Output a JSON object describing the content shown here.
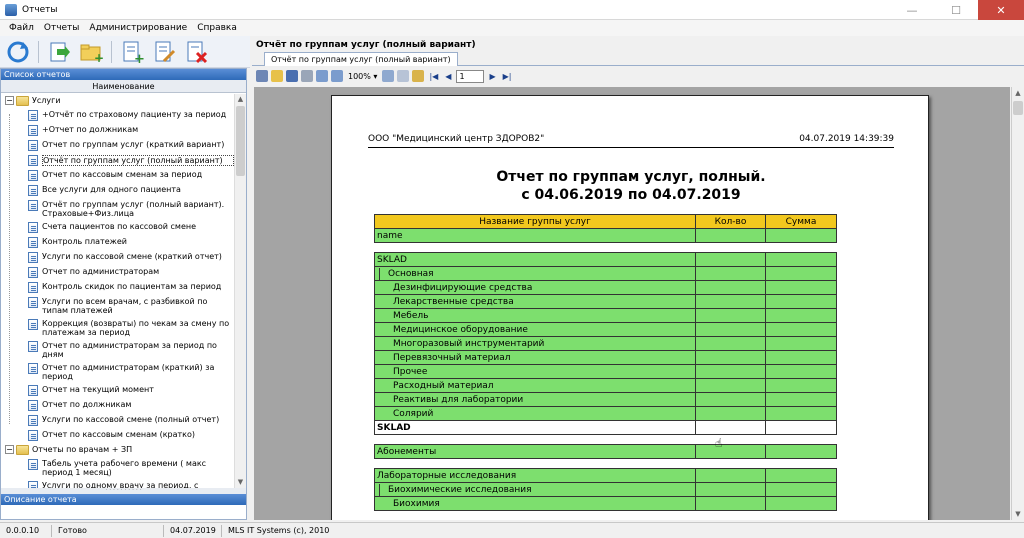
{
  "window": {
    "title": "Отчеты",
    "minimize": "—",
    "maximize": "☐",
    "close": "✕"
  },
  "menu": [
    "Файл",
    "Отчеты",
    "Администрирование",
    "Справка"
  ],
  "left_panel": {
    "header": "Список отчетов",
    "column": "Наименование",
    "description_header": "Описание отчета",
    "tree": [
      {
        "type": "folder",
        "label": "Услуги"
      },
      {
        "type": "doc",
        "label": "+Отчёт по страховому пациенту за период"
      },
      {
        "type": "doc",
        "label": " +Отчет по должникам"
      },
      {
        "type": "doc",
        "label": "Отчет по группам услуг (краткий вариант)"
      },
      {
        "type": "doc",
        "label": "Отчёт по группам услуг (полный вариант)",
        "selected": true
      },
      {
        "type": "doc",
        "label": "Отчет по кассовым сменам за период"
      },
      {
        "type": "doc",
        "label": "Все услуги для одного пациента"
      },
      {
        "type": "doc",
        "label": "Отчёт по группам услуг (полный вариант). Страховые+Физ.лица"
      },
      {
        "type": "doc",
        "label": "Счета пациентов по кассовой смене"
      },
      {
        "type": "doc",
        "label": "Контроль платежей"
      },
      {
        "type": "doc",
        "label": "Услуги по кассовой смене  (краткий отчет)"
      },
      {
        "type": "doc",
        "label": "Отчет по администраторам"
      },
      {
        "type": "doc",
        "label": "Контроль скидок по пациентам за период"
      },
      {
        "type": "doc",
        "label": "Услуги по всем врачам, с разбивкой по типам платежей"
      },
      {
        "type": "doc",
        "label": "Коррекция (возвраты) по чекам за смену по платежам за период"
      },
      {
        "type": "doc",
        "label": "Отчет по администраторам за период по дням"
      },
      {
        "type": "doc",
        "label": "Отчет по администраторам (краткий) за период"
      },
      {
        "type": "doc",
        "label": "Отчет на текущий момент"
      },
      {
        "type": "doc",
        "label": " Отчет по должникам"
      },
      {
        "type": "doc",
        "label": "Услуги по кассовой смене (полный отчет)"
      },
      {
        "type": "doc",
        "label": "Отчет по кассовым сменам (кратко)"
      },
      {
        "type": "folder",
        "label": "Отчеты по врачам + ЗП"
      },
      {
        "type": "doc",
        "label": "Табель учета рабочего времени ( макс период 1 месяц)"
      },
      {
        "type": "doc",
        "label": "Услуги по одному врачу за период, с группировкой по группам услуг"
      }
    ]
  },
  "report_panel": {
    "title": "Отчёт по группам услуг (полный вариант)",
    "tab": "Отчёт по группам услуг (полный вариант)",
    "zoom": "100%",
    "page_number": "1"
  },
  "report": {
    "organization": "ООО \"Медицинский центр ЗДОРОВ2\"",
    "printed": "04.07.2019 14:39:39",
    "title_line1": "Отчет по группам услуг, полный.",
    "title_line2": "с 04.06.2019 по 04.07.2019",
    "columns": [
      "Название группы услуг",
      "Кол-во",
      "Сумма"
    ],
    "rows": {
      "name": "name",
      "sklad": "SKLAD",
      "osnovnaya": "Основная",
      "items": [
        "Дезинфицирующие средства",
        "Лекарственные средства",
        "Мебель",
        "Медицинское оборудование",
        "Многоразовый инструментарий",
        "Перевязочный материал",
        "Прочее",
        "Расходный материал",
        "Реактивы для лаборатории",
        "Солярий"
      ],
      "sklad_total": "SKLAD",
      "abonementy": "Абонементы",
      "lab": "Лабораторные исследования",
      "biochem": "Биохимические исследования",
      "biochemiya": "Биохимия"
    }
  },
  "status": {
    "version": "0.0.0.10",
    "state": "Готово",
    "date": "04.07.2019",
    "copyright": "MLS IT Systems (c), 2010"
  }
}
